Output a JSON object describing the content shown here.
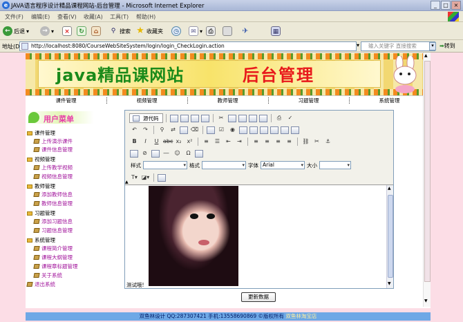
{
  "window": {
    "title": "JAVA语言程序设计精品课程网站-后台管理 - Microsoft Internet Explorer",
    "minimize": "_",
    "maximize": "□",
    "close": "×"
  },
  "menu": [
    "文件(F)",
    "编辑(E)",
    "查看(V)",
    "收藏(A)",
    "工具(T)",
    "帮助(H)"
  ],
  "toolbar": {
    "back": "后退",
    "search": "搜索",
    "favorites": "收藏夹"
  },
  "address": {
    "label": "地址(D)",
    "url": "http://localhost:8080/CourseWebSiteSystem/login/login_CheckLogin.action",
    "search_placeholder": "输入关键字 直接搜索",
    "go": "转到"
  },
  "banner": {
    "title_green": "java精品课网站",
    "title_red": "后台管理"
  },
  "nav": [
    "课件管理",
    "视频管理",
    "教师管理",
    "习题管理",
    "系统管理"
  ],
  "sidebar": {
    "heading": "用户菜单",
    "groups": [
      {
        "label": "课件管理",
        "items": [
          "上传演示课件",
          "课件信息管理"
        ]
      },
      {
        "label": "视频管理",
        "items": [
          "上传教学视频",
          "视频信息管理"
        ]
      },
      {
        "label": "教师管理",
        "items": [
          "添加教师信息",
          "教师信息管理"
        ]
      },
      {
        "label": "习题管理",
        "items": [
          "添加习题信息",
          "习题信息管理"
        ]
      },
      {
        "label": "系统管理",
        "items": [
          "课程简介管理",
          "课程大纲管理",
          "课程章标题管理",
          "关于系统"
        ]
      }
    ],
    "logout": "退出系统"
  },
  "editor": {
    "source_button": "源代码",
    "style_label": "样式",
    "format_label": "格式",
    "font_label": "字体",
    "font_value": "Arial",
    "size_label": "大小",
    "body_caption": "测试哦!"
  },
  "submit_label": "更新数据",
  "footer": {
    "text": "双鱼林设计 QQ:287307421 手机:13558690869 ©版权所有",
    "shop": "双鱼林淘宝店"
  }
}
